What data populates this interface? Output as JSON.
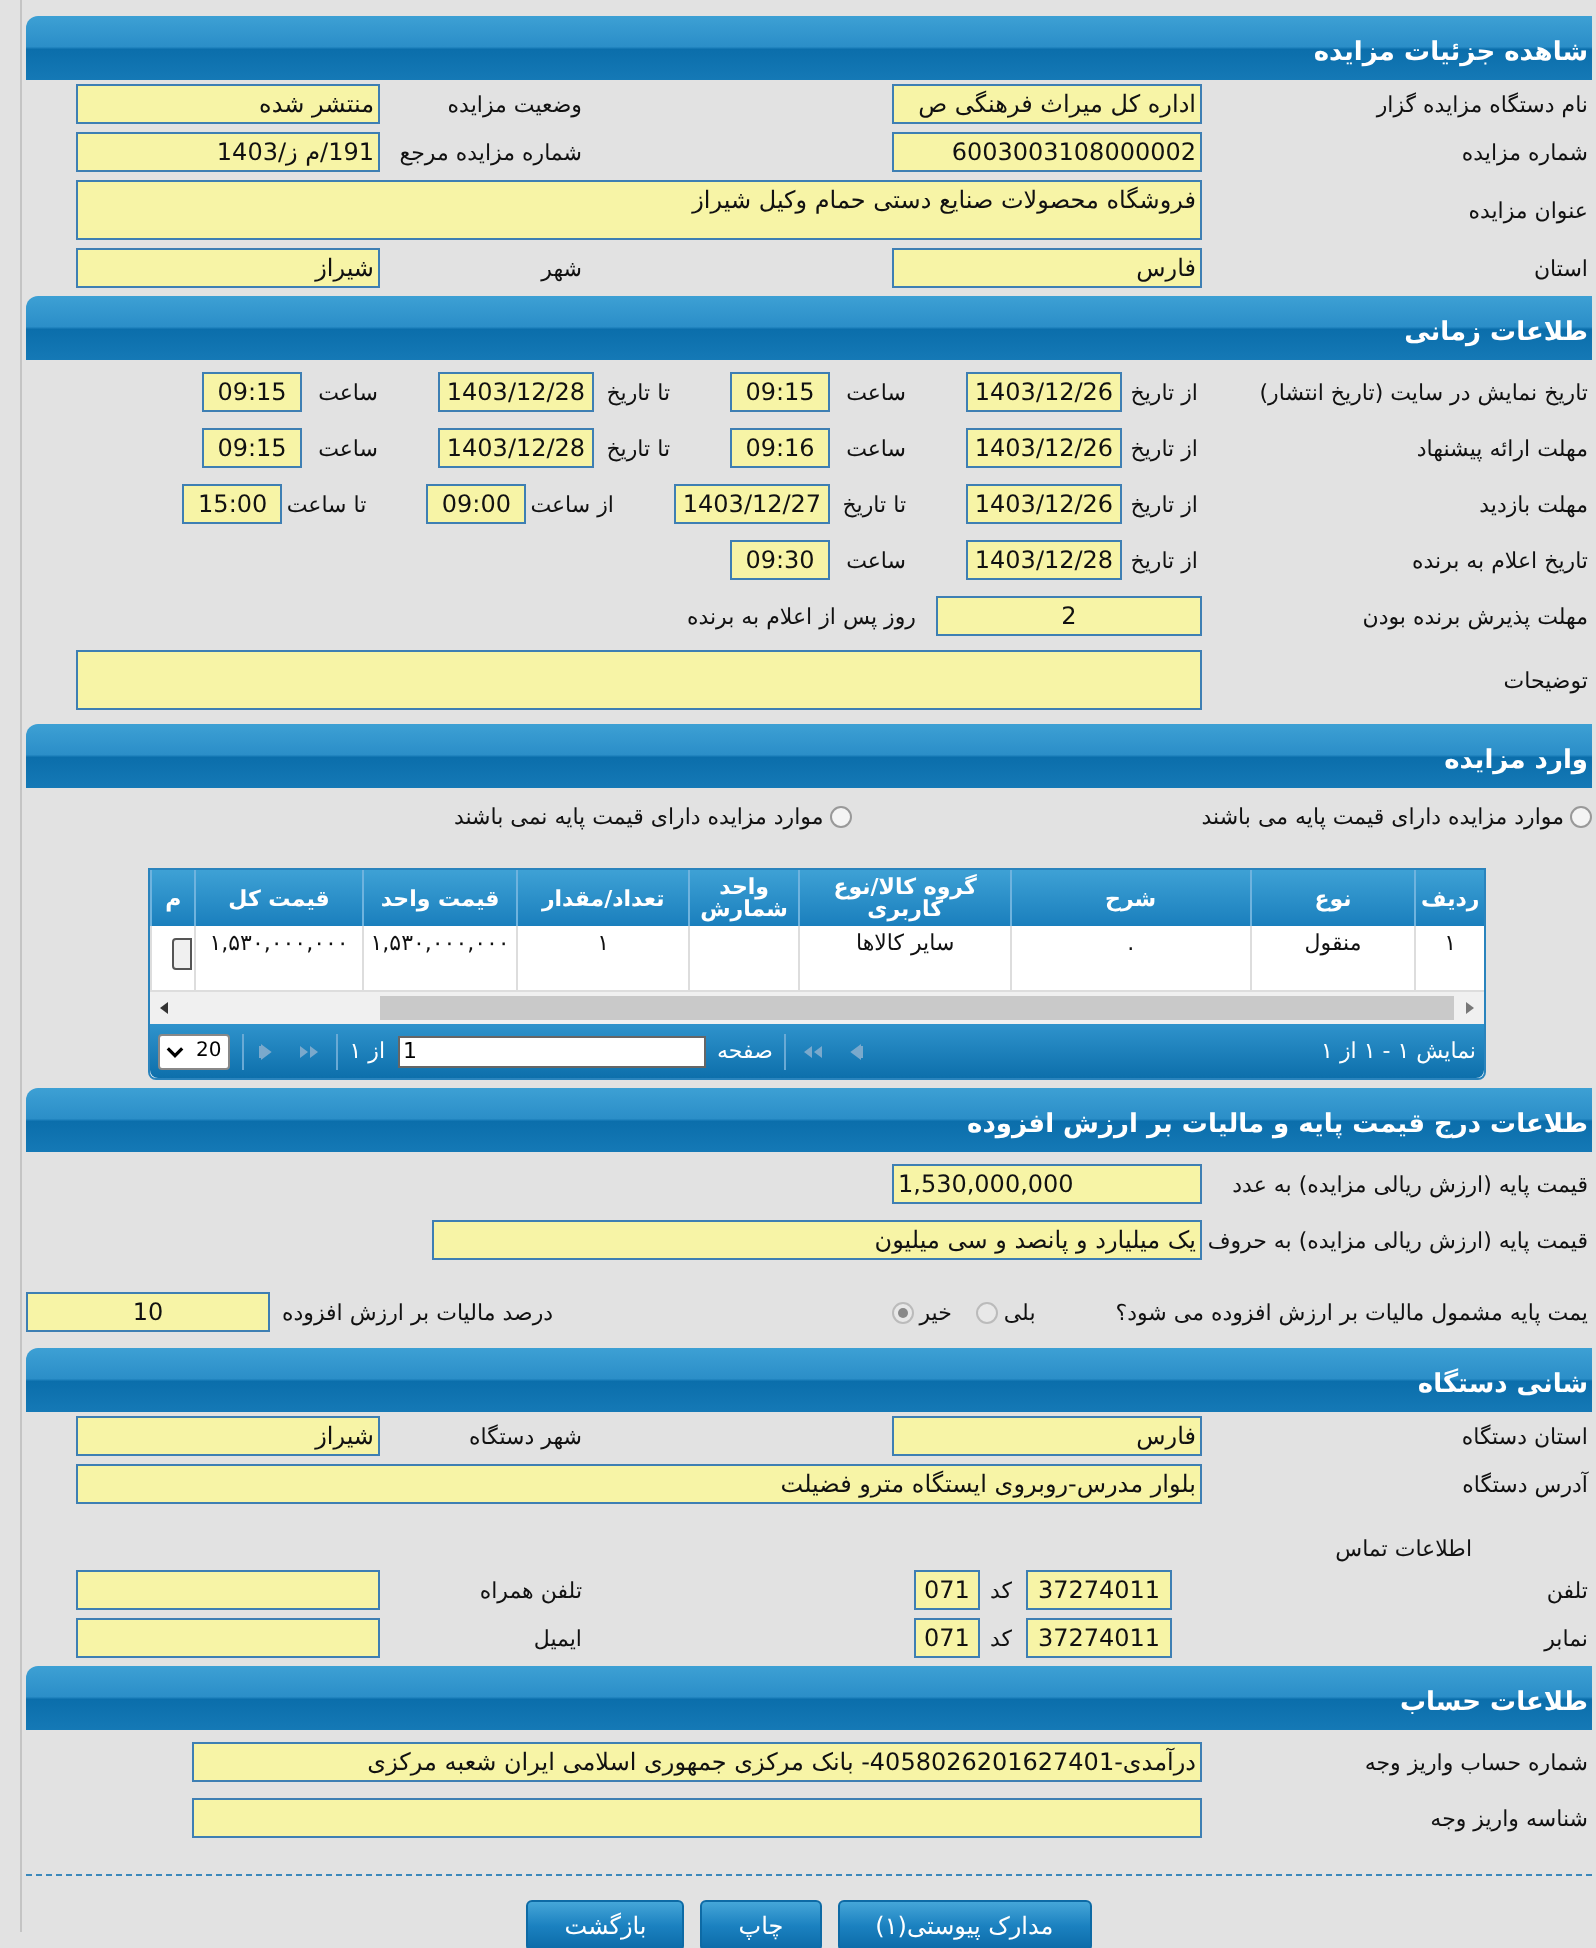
{
  "details": {
    "title": "شاهده جزئیات مزایده",
    "fields": [
      {
        "kind": "half",
        "label": "نام دستگاه مزایده گزار",
        "value": "اداره کل میراث فرهنگی  ص"
      },
      {
        "kind": "half",
        "label": "وضعیت مزایده",
        "value": "منتشر شده"
      },
      {
        "kind": "half",
        "label": "شماره مزایده",
        "value": "6003003108000002"
      },
      {
        "kind": "half",
        "label": "شماره مزایده مرجع",
        "value": "191/م ز/1403"
      },
      {
        "kind": "wide",
        "label": "عنوان مزایده",
        "value": "فروشگاه محصولات صنایع دستی حمام وکیل شیراز"
      },
      {
        "kind": "half",
        "label": "استان",
        "value": "فارس"
      },
      {
        "kind": "half",
        "label": "شهر",
        "value": "شیراز"
      }
    ]
  },
  "schedule": {
    "title": "طلاعات زمانی",
    "rows": [
      {
        "label": "تاریخ نمایش در سایت (تاریخ انتشار)",
        "slots": [
          {
            "kind": "date",
            "label": "از تاریخ",
            "value": "1403/12/26"
          },
          {
            "kind": "time",
            "label": "ساعت",
            "value": "09:15"
          },
          {
            "kind": "date",
            "label": "تا تاریخ",
            "value": "1403/12/28"
          },
          {
            "kind": "time",
            "label": "ساعت",
            "value": "09:15"
          }
        ]
      },
      {
        "label": "مهلت ارائه پیشنهاد",
        "slots": [
          {
            "kind": "date",
            "label": "از تاریخ",
            "value": "1403/12/26"
          },
          {
            "kind": "time",
            "label": "ساعت",
            "value": "09:16"
          },
          {
            "kind": "date",
            "label": "تا تاریخ",
            "value": "1403/12/28"
          },
          {
            "kind": "time",
            "label": "ساعت",
            "value": "09:15"
          }
        ]
      },
      {
        "label": "مهلت بازدید",
        "slots": [
          {
            "kind": "date",
            "label": "از تاریخ",
            "value": "1403/12/26"
          },
          {
            "kind": "date",
            "label": "تا تاریخ",
            "value": "1403/12/27"
          },
          {
            "kind": "time",
            "label": "از ساعت",
            "value": "09:00"
          },
          {
            "kind": "time",
            "label": "تا ساعت",
            "value": "15:00"
          }
        ]
      },
      {
        "label": "تاریخ اعلام به برنده",
        "slots": [
          {
            "kind": "date",
            "label": "از تاریخ",
            "value": "1403/12/28"
          },
          {
            "kind": "time",
            "label": "ساعت",
            "value": "09:30"
          }
        ]
      }
    ],
    "acceptance": {
      "label": "مهلت پذیرش برنده بودن",
      "value": "2",
      "suffix": "روز پس از اعلام به برنده"
    },
    "notes": {
      "label": "توضیحات"
    }
  },
  "items": {
    "title": "وارد مزایده",
    "filters": [
      {
        "label": "موارد مزایده دارای قیمت پایه می باشند",
        "selected": false
      },
      {
        "label": "موارد مزایده دارای قیمت پایه نمی باشند",
        "selected": false
      }
    ],
    "table": {
      "columns": [
        "ردیف",
        "نوع",
        "شرح",
        "گروه کالا/نوع کاربری",
        "واحد شمارش",
        "تعداد/مقدار",
        "قیمت واحد",
        "قیمت کل",
        "م"
      ],
      "rows": [
        {
          "cells": [
            "۱",
            "منقول",
            ".",
            "سایر کالاها",
            null,
            "۱",
            "۱,۵۳۰,۰۰۰,۰۰۰",
            "۱,۵۳۰,۰۰۰,۰۰۰",
            null
          ]
        }
      ]
    },
    "pager": {
      "summary": "نمایش ۱ - ۱ از ۱",
      "page_label": "صفحه",
      "page": "1",
      "page_count": "از ۱",
      "page_size": "20"
    }
  },
  "price": {
    "title": "طلاعات درج قیمت پایه و مالیات بر ارزش افزوده",
    "fields": [
      {
        "label": "قیمت پایه (ارزش ریالی مزایده) به عدد",
        "value": "1,530,000,000"
      },
      {
        "label": "قیمت پایه (ارزش ریالی مزایده) به حروف",
        "value": "یک میلیارد و پانصد و سی میلیون"
      }
    ],
    "vat_question": {
      "label": "یمت پایه مشمول مالیات بر ارزش افزوده می شود؟",
      "options": [
        {
          "label": "بلی",
          "selected": false
        },
        {
          "label": "خیر",
          "selected": true
        }
      ]
    },
    "vat_rate": {
      "label": "درصد مالیات بر ارزش افزوده",
      "value": "10"
    }
  },
  "address": {
    "title": "شانی دستگاه",
    "fields": [
      {
        "kind": "half",
        "label": "استان دستگاه",
        "value": "فارس"
      },
      {
        "kind": "half",
        "label": "شهر دستگاه",
        "value": "شیراز"
      },
      {
        "kind": "wide",
        "label": "آدرس دستگاه",
        "value": "بلوار مدرس-روبروی ایستگاه مترو فضیلت"
      }
    ],
    "contact_title": "اطلاعات تماس",
    "contacts": [
      {
        "label": "تلفن",
        "number": "37274011",
        "code_label": "کد",
        "code": "071",
        "extra_label": "تلفن همراه"
      },
      {
        "label": "نمابر",
        "number": "37274011",
        "code_label": "کد",
        "code": "071",
        "extra_label": "ایمیل"
      }
    ]
  },
  "account": {
    "title": "طلاعات حساب",
    "fields": [
      {
        "label": "شماره حساب واریز وجه",
        "value": "درآمدی-4058026201627401- بانک مرکزی جمهوری اسلامی ایران شعبه مرکزی"
      },
      {
        "label": "شناسه واریز وجه"
      }
    ]
  },
  "buttons": [
    "مدارک پیوستی(۱)",
    "چاپ",
    "بازگشت"
  ]
}
